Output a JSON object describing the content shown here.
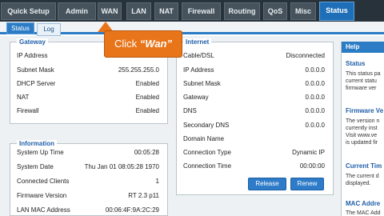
{
  "top_tabs": [
    "Quick Setup",
    "Admin",
    "WAN",
    "LAN",
    "NAT",
    "Firewall",
    "Routing",
    "QoS",
    "Misc",
    "Status"
  ],
  "active_top_tab": "Status",
  "sub_tabs": [
    "Status",
    "Log"
  ],
  "active_sub_tab": "Log",
  "callout": {
    "prefix": "Click ",
    "target": "“Wan”"
  },
  "gateway": {
    "title": "Gateway",
    "rows": [
      {
        "label": "IP Address",
        "value": ""
      },
      {
        "label": "Subnet Mask",
        "value": "255.255.255.0"
      },
      {
        "label": "DHCP Server",
        "value": "Enabled"
      },
      {
        "label": "NAT",
        "value": "Enabled"
      },
      {
        "label": "Firewall",
        "value": "Enabled"
      }
    ]
  },
  "information": {
    "title": "Information",
    "rows": [
      {
        "label": "System Up Time",
        "value": "00:05:28"
      },
      {
        "label": "System Date",
        "value": "Thu Jan 01 08:05:28 1970"
      },
      {
        "label": "Connected Clients",
        "value": "1"
      },
      {
        "label": "Firmware Version",
        "value": "RT 2.3 p11"
      },
      {
        "label": "LAN MAC Address",
        "value": "00:06:4F:9A:2C:29"
      }
    ]
  },
  "internet": {
    "title": "Internet",
    "rows": [
      {
        "label": "Cable/DSL",
        "value": "Disconnected"
      },
      {
        "label": "IP Address",
        "value": "0.0.0.0"
      },
      {
        "label": "Subnet Mask",
        "value": "0.0.0.0"
      },
      {
        "label": "Gateway",
        "value": "0.0.0.0"
      },
      {
        "label": "DNS",
        "value": "0.0.0.0"
      },
      {
        "label": "Secondary DNS",
        "value": "0.0.0.0"
      },
      {
        "label": "Domain Name",
        "value": ""
      },
      {
        "label": "Connection Type",
        "value": "Dynamic IP"
      },
      {
        "label": "Connection Time",
        "value": "00:00:00"
      }
    ],
    "release_label": "Release",
    "renew_label": "Renew"
  },
  "help": {
    "header": "Help",
    "sections": [
      {
        "title": "Status",
        "lines": [
          "This status pa",
          "current statu",
          "firmware ver"
        ]
      },
      {
        "title": "Firmware Ve",
        "lines": [
          "The version n",
          "currently inst",
          "Visit www.ve",
          "is updated fir"
        ]
      },
      {
        "title": "Current Tim",
        "lines": [
          "The current d",
          "displayed."
        ]
      },
      {
        "title": "MAC Addre",
        "lines": [
          "The MAC Add"
        ]
      }
    ]
  }
}
